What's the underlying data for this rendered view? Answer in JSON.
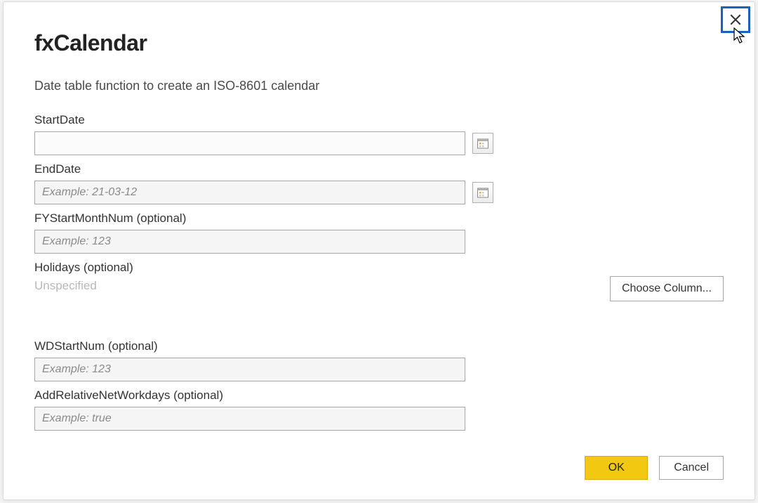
{
  "dialog": {
    "title": "fxCalendar",
    "description": "Date table function to create an ISO-8601 calendar",
    "fields": {
      "startDate": {
        "label": "StartDate",
        "value": "",
        "placeholder": ""
      },
      "endDate": {
        "label": "EndDate",
        "value": "",
        "placeholder": "Example: 21-03-12"
      },
      "fyStartMonthNum": {
        "label": "FYStartMonthNum (optional)",
        "value": "",
        "placeholder": "Example: 123"
      },
      "holidays": {
        "label": "Holidays (optional)",
        "statusText": "Unspecified",
        "chooseColumnLabel": "Choose Column..."
      },
      "wdStartNum": {
        "label": "WDStartNum (optional)",
        "value": "",
        "placeholder": "Example: 123"
      },
      "addRelativeNetWorkdays": {
        "label": "AddRelativeNetWorkdays (optional)",
        "value": "",
        "placeholder": "Example: true"
      }
    },
    "buttons": {
      "ok": "OK",
      "cancel": "Cancel"
    }
  }
}
